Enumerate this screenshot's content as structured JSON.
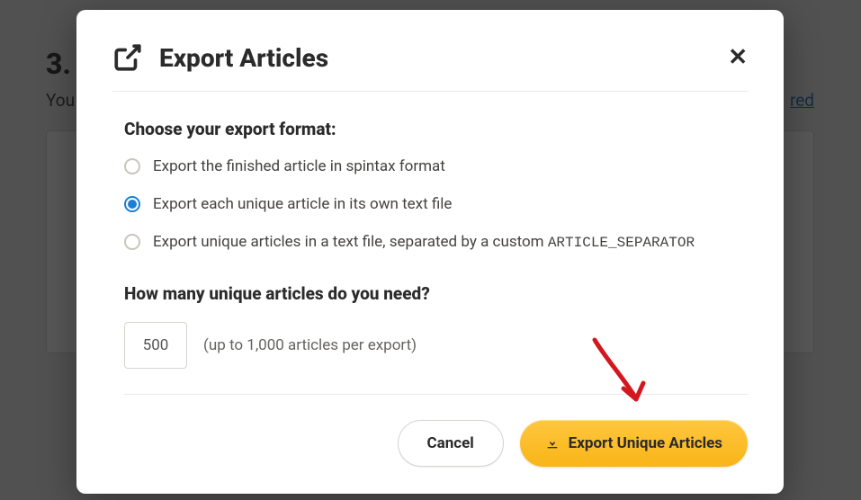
{
  "backdrop": {
    "stepNumber": "3.",
    "intro": "You",
    "link": "red"
  },
  "modal": {
    "title": "Export Articles",
    "formatLabel": "Choose your export format:",
    "options": [
      {
        "label": "Export the finished article in spintax format",
        "checked": false
      },
      {
        "label": "Export each unique article in its own text file",
        "checked": true
      },
      {
        "label": "Export unique articles in a text file, separated by a custom ",
        "code": "ARTICLE_SEPARATOR",
        "checked": false
      }
    ],
    "countLabel": "How many unique articles do you need?",
    "countValue": "500",
    "countHint": "(up to 1,000 articles per export)",
    "buttons": {
      "cancel": "Cancel",
      "export": "Export Unique Articles"
    }
  }
}
